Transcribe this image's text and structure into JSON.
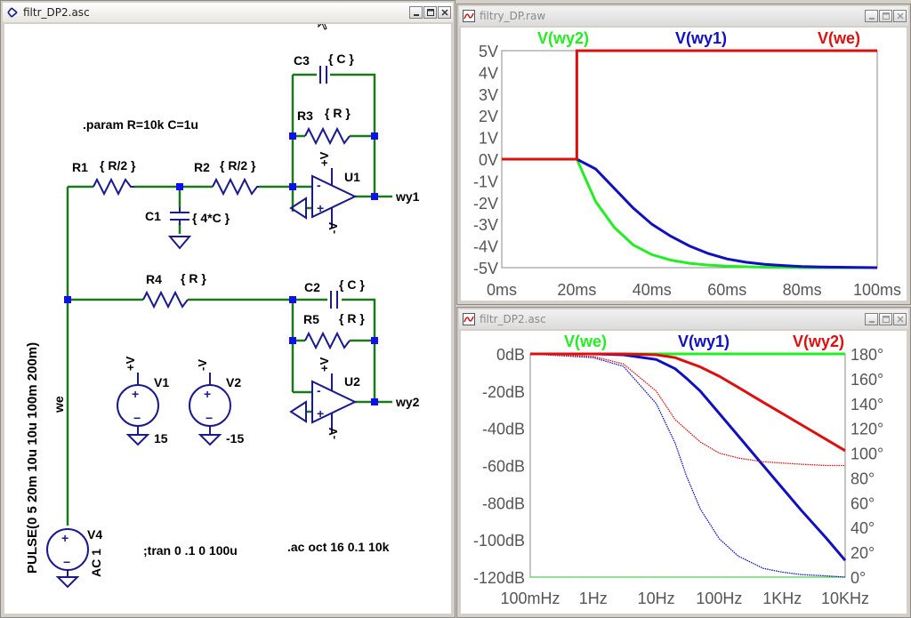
{
  "windows": {
    "schematic": {
      "title": "filtr_DP2.asc"
    },
    "transient": {
      "title": "filtry_DP.raw"
    },
    "ac": {
      "title": "filtr_DP2.asc"
    }
  },
  "schematic": {
    "param": ".param R=10k   C=1u",
    "tran": ";tran 0 .1 0 100u",
    "ac": ".ac oct 16 0.1 10k",
    "components": {
      "r1": {
        "name": "R1",
        "value": "{ R/2 }"
      },
      "r2": {
        "name": "R2",
        "value": "{ R/2 }"
      },
      "c1": {
        "name": "C1",
        "value": "{ 4*C }"
      },
      "c3": {
        "name": "C3",
        "value": "{ C }"
      },
      "r3": {
        "name": "R3",
        "value": "{ R }"
      },
      "u1": {
        "name": "U1"
      },
      "r4": {
        "name": "R4",
        "value": "{ R }"
      },
      "c2": {
        "name": "C2",
        "value": "{ C }"
      },
      "r5": {
        "name": "R5",
        "value": "{ R }"
      },
      "u2": {
        "name": "U2"
      },
      "v1": {
        "name": "V1",
        "value": "15"
      },
      "v2": {
        "name": "V2",
        "value": "-15"
      },
      "v4": {
        "name": "V4",
        "value": "AC 1",
        "pulse": "PULSE(0 5 20m 10u 10u 100m 200m)"
      }
    },
    "nets": {
      "we": "we",
      "wy1": "wy1",
      "wy2": "wy2"
    },
    "supply": {
      "pos": "+V",
      "neg": "-V"
    }
  },
  "colors": {
    "green": "#22ee22",
    "blue": "#1010c0",
    "red": "#dd1010",
    "wire": "#1a7a1a",
    "comp": "#1a1a8c",
    "node": "#1010ee"
  },
  "chart_data": [
    {
      "type": "line",
      "title": "",
      "legend": [
        "V(wy2)",
        "V(wy1)",
        "V(we)"
      ],
      "x_ticks": [
        "0ms",
        "20ms",
        "40ms",
        "60ms",
        "80ms",
        "100ms"
      ],
      "y_ticks": [
        "5V",
        "4V",
        "3V",
        "2V",
        "1V",
        "0V",
        "-1V",
        "-2V",
        "-3V",
        "-4V",
        "-5V"
      ],
      "xlim": [
        0,
        100
      ],
      "ylim": [
        -5,
        5
      ],
      "series": [
        {
          "name": "V(we)",
          "color": "red",
          "x": [
            0,
            20,
            20,
            100
          ],
          "y": [
            0,
            0,
            5,
            5
          ]
        },
        {
          "name": "V(wy1)",
          "color": "blue",
          "x": [
            0,
            20,
            25,
            30,
            35,
            40,
            45,
            50,
            55,
            60,
            65,
            70,
            75,
            80,
            85,
            90,
            95,
            100
          ],
          "y": [
            0,
            0,
            -0.45,
            -1.35,
            -2.25,
            -3.0,
            -3.55,
            -4.0,
            -4.35,
            -4.6,
            -4.75,
            -4.85,
            -4.9,
            -4.95,
            -4.97,
            -4.98,
            -4.99,
            -5.0
          ]
        },
        {
          "name": "V(wy2)",
          "color": "green",
          "x": [
            0,
            20,
            25,
            30,
            35,
            40,
            45,
            50,
            55,
            60,
            65,
            70,
            75,
            80,
            85,
            90,
            95,
            100
          ],
          "y": [
            0,
            0,
            -1.95,
            -3.15,
            -3.95,
            -4.4,
            -4.65,
            -4.8,
            -4.88,
            -4.93,
            -4.96,
            -4.98,
            -4.99,
            -5.0,
            -5.0,
            -5.0,
            -5.0,
            -5.0
          ]
        }
      ]
    },
    {
      "type": "line",
      "title": "",
      "x_scale": "log",
      "legend": [
        "V(we)",
        "V(wy1)",
        "V(wy2)"
      ],
      "x_ticks": [
        "100mHz",
        "1Hz",
        "10Hz",
        "100Hz",
        "1KHz",
        "10KHz"
      ],
      "y_ticks": [
        "0dB",
        "-20dB",
        "-40dB",
        "-60dB",
        "-80dB",
        "-100dB",
        "-120dB"
      ],
      "y2_ticks": [
        "180°",
        "160°",
        "140°",
        "120°",
        "100°",
        "80°",
        "60°",
        "40°",
        "20°",
        "0°"
      ],
      "xlim": [
        0.1,
        10000
      ],
      "ylim": [
        -120,
        0
      ],
      "y2lim": [
        0,
        180
      ],
      "series": [
        {
          "name": "V(we)",
          "color": "green",
          "x": [
            0.1,
            10000
          ],
          "mag": [
            0,
            0
          ],
          "phase": [
            0,
            0
          ]
        },
        {
          "name": "V(wy1)",
          "color": "blue",
          "x": [
            0.1,
            1,
            3,
            10,
            20,
            30,
            50,
            100,
            200,
            500,
            1000,
            2000,
            5000,
            10000
          ],
          "mag": [
            0,
            0,
            -0.5,
            -3,
            -8,
            -13,
            -20,
            -32,
            -44,
            -60,
            -72,
            -84,
            -99,
            -111
          ],
          "phase": [
            180,
            177,
            170,
            140,
            108,
            82,
            55,
            31,
            17,
            7,
            4,
            2,
            1,
            0
          ]
        },
        {
          "name": "V(wy2)",
          "color": "red",
          "x": [
            0.1,
            1,
            3,
            10,
            20,
            50,
            100,
            200,
            500,
            1000,
            2000,
            5000,
            10000
          ],
          "mag": [
            0,
            0,
            0,
            -0.5,
            -2,
            -7,
            -12,
            -18,
            -26,
            -32,
            -38,
            -46,
            -52
          ],
          "phase": [
            180,
            178,
            172,
            150,
            127,
            109,
            100,
            96,
            93,
            92,
            91,
            90,
            90
          ]
        }
      ]
    }
  ]
}
